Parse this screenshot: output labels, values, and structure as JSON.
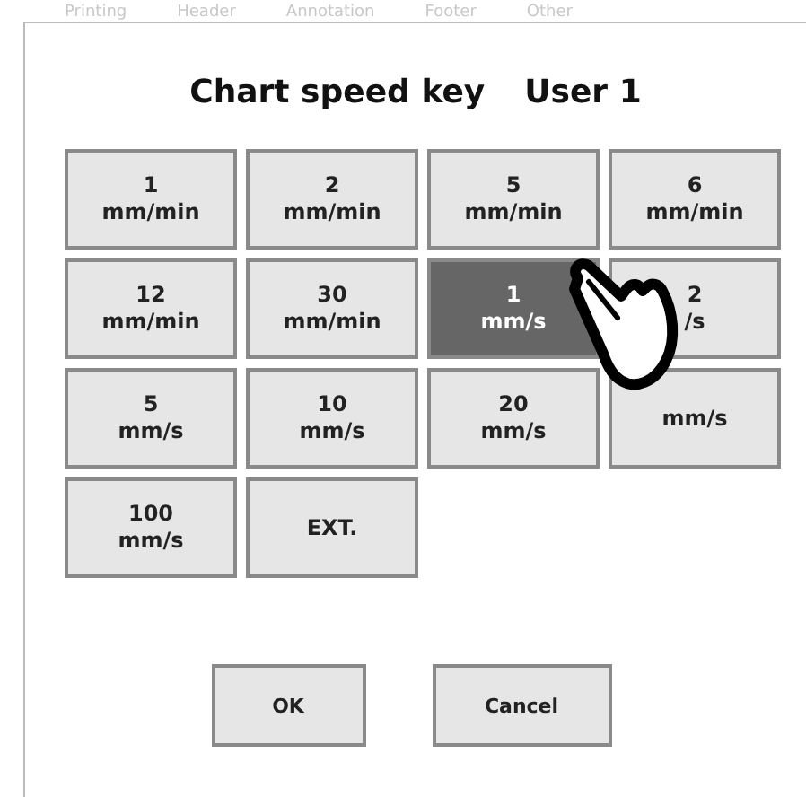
{
  "background_tabs": [
    "Printing",
    "Header",
    "Annotation",
    "Footer",
    "Other"
  ],
  "dialog": {
    "title": "Chart speed key",
    "user": "User 1",
    "keys": [
      {
        "value": "1",
        "unit": "mm/min",
        "selected": false
      },
      {
        "value": "2",
        "unit": "mm/min",
        "selected": false
      },
      {
        "value": "5",
        "unit": "mm/min",
        "selected": false
      },
      {
        "value": "6",
        "unit": "mm/min",
        "selected": false
      },
      {
        "value": "12",
        "unit": "mm/min",
        "selected": false
      },
      {
        "value": "30",
        "unit": "mm/min",
        "selected": false
      },
      {
        "value": "1",
        "unit": "mm/s",
        "selected": true
      },
      {
        "value": "2",
        "unit": "/s",
        "selected": false
      },
      {
        "value": "5",
        "unit": "mm/s",
        "selected": false
      },
      {
        "value": "10",
        "unit": "mm/s",
        "selected": false
      },
      {
        "value": "20",
        "unit": "mm/s",
        "selected": false
      },
      {
        "unit": "mm/s",
        "selected": false
      },
      {
        "value": "100",
        "unit": "mm/s",
        "selected": false
      },
      {
        "value": "EXT.",
        "selected": false
      }
    ],
    "buttons": [
      "OK",
      "Cancel"
    ]
  }
}
